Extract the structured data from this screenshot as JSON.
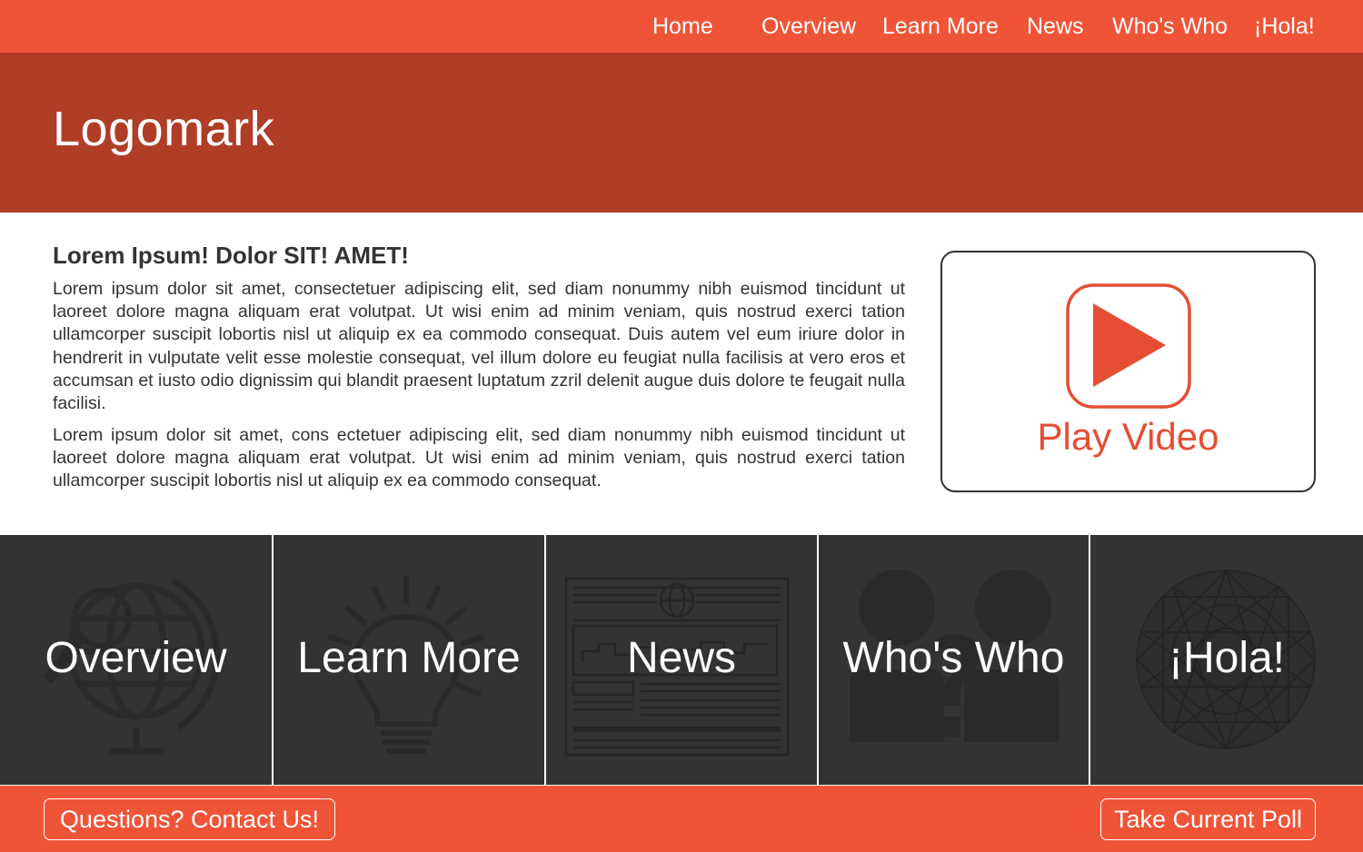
{
  "nav": {
    "items": [
      {
        "label": "Home"
      },
      {
        "label": "Overview"
      },
      {
        "label": "Learn More"
      },
      {
        "label": "News"
      },
      {
        "label": "Who's Who"
      },
      {
        "label": "¡Hola!"
      }
    ]
  },
  "header": {
    "logo": "Logomark"
  },
  "main": {
    "heading": "Lorem Ipsum! Dolor SIT! AMET!",
    "paragraphs": [
      "Lorem ipsum dolor sit amet, consectetuer adipiscing elit, sed diam nonummy nibh euismod tincidunt ut laoreet dolore magna aliquam erat volutpat. Ut wisi enim ad minim veniam, quis nostrud exerci tation ullamcorper suscipit lobortis nisl ut aliquip ex ea commodo consequat. Duis autem vel eum iriure dolor in hendrerit in vulputate velit esse molestie consequat, vel illum dolore eu feugiat nulla facilisis at vero eros et accumsan et iusto odio dignissim qui blandit praesent luptatum zzril delenit augue duis dolore te feugait nulla facilisi.",
      "Lorem ipsum dolor sit amet, cons ectetuer adipiscing elit, sed diam nonummy nibh euismod tincidunt ut laoreet dolore magna aliquam erat volutpat. Ut wisi enim ad minim veniam, quis nostrud exerci tation ullamcorper suscipit lobortis nisl ut aliquip ex ea commodo consequat."
    ]
  },
  "video": {
    "label": "Play Video",
    "icon": "play-icon"
  },
  "tiles": [
    {
      "label": "Overview",
      "icon": "globe-icon"
    },
    {
      "label": "Learn More",
      "icon": "lightbulb-icon"
    },
    {
      "label": "News",
      "icon": "newspaper-icon"
    },
    {
      "label": "Who's Who",
      "icon": "people-question-icon"
    },
    {
      "label": "¡Hola!",
      "icon": "mandala-icon"
    }
  ],
  "footer": {
    "contact_label": "Questions? Contact Us!",
    "poll_label": "Take Current Poll"
  },
  "colors": {
    "nav_bg": "#f05436",
    "header_bg": "#b03d26",
    "tile_bg": "#333333",
    "accent": "#e54e33",
    "footer_bg": "#f05436"
  }
}
